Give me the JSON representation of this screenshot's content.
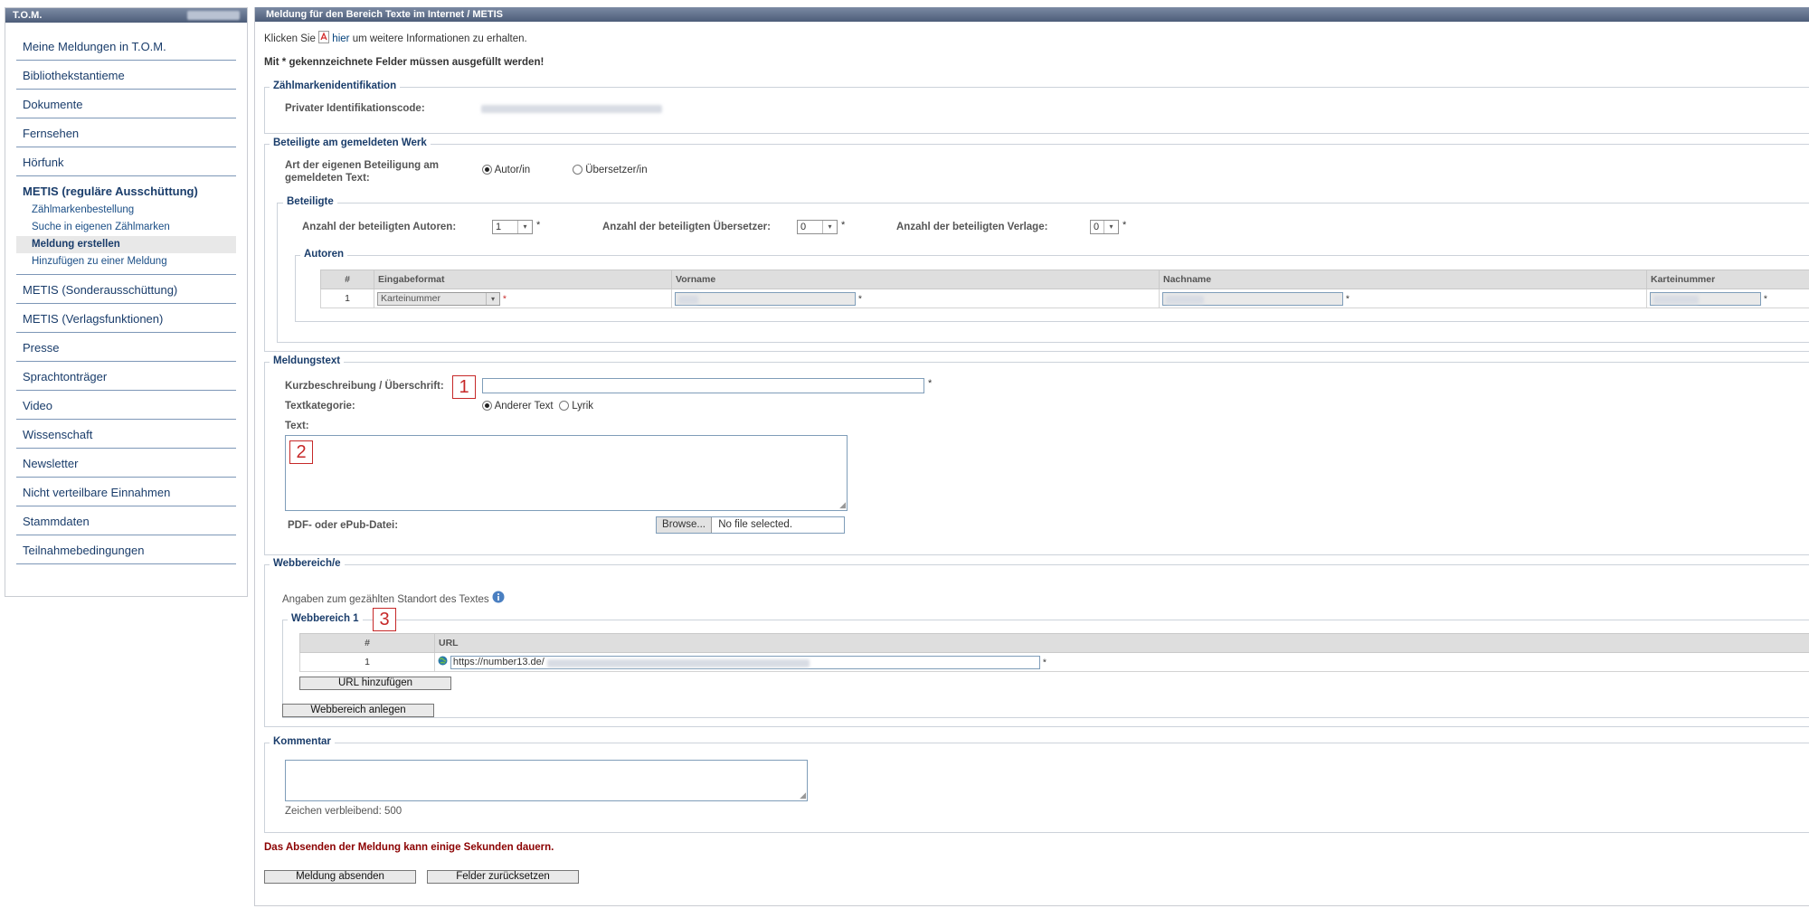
{
  "sidebar": {
    "title": "T.O.M.",
    "items": [
      {
        "label": "Meine Meldungen in T.O.M."
      },
      {
        "label": "Bibliothekstantieme"
      },
      {
        "label": "Dokumente"
      },
      {
        "label": "Fernsehen"
      },
      {
        "label": "Hörfunk"
      },
      {
        "label": "METIS (reguläre Ausschüttung)"
      },
      {
        "label": "METIS (Sonderausschüttung)"
      },
      {
        "label": "METIS (Verlagsfunktionen)"
      },
      {
        "label": "Presse"
      },
      {
        "label": "Sprachtonträger"
      },
      {
        "label": "Video"
      },
      {
        "label": "Wissenschaft"
      },
      {
        "label": "Newsletter"
      },
      {
        "label": "Nicht verteilbare Einnahmen"
      },
      {
        "label": "Stammdaten"
      },
      {
        "label": "Teilnahmebedingungen"
      }
    ],
    "subitems": [
      {
        "label": "Zählmarkenbestellung"
      },
      {
        "label": "Suche in eigenen Zählmarken"
      },
      {
        "label": "Meldung erstellen"
      },
      {
        "label": "Hinzufügen zu einer Meldung"
      }
    ]
  },
  "main": {
    "title": "Meldung für den Bereich Texte im Internet / METIS",
    "info_prefix": "Klicken Sie",
    "info_link": "hier",
    "info_suffix": "um weitere Informationen zu erhalten.",
    "required_note": "Mit * gekennzeichnete Felder müssen ausgefüllt werden!",
    "zaehlmarke": {
      "legend": "Zählmarkenidentifikation",
      "code_label": "Privater Identifikationscode:"
    },
    "beteiligte": {
      "legend": "Beteiligte am gemeldeten Werk",
      "art_label": "Art der eigenen Beteiligung am gemeldeten Text:",
      "opt_autor": "Autor/in",
      "opt_uebersetzer": "Übersetzer/in",
      "sub_legend": "Beteiligte",
      "autoren_label": "Anzahl der beteiligten Autoren:",
      "autoren_value": "1",
      "uebersetzer_label": "Anzahl der beteiligten Übersetzer:",
      "uebersetzer_value": "0",
      "verlage_label": "Anzahl der beteiligten Verlage:",
      "verlage_value": "0",
      "autoren_legend": "Autoren",
      "table_headers": [
        "#",
        "Eingabeformat",
        "Vorname",
        "Nachname",
        "Karteinummer"
      ],
      "row_num": "1",
      "row_format": "Karteinummer"
    },
    "meldungstext": {
      "legend": "Meldungstext",
      "kurz_label": "Kurzbeschreibung / Überschrift:",
      "kat_label": "Textkategorie:",
      "opt_anderer": "Anderer Text",
      "opt_lyrik": "Lyrik",
      "text_label": "Text:",
      "pdf_label": "PDF- oder ePub-Datei:",
      "browse": "Browse...",
      "no_file": "No file selected."
    },
    "webbereich": {
      "legend": "Webbereich/e",
      "hint": "Angaben zum gezählten Standort des Textes",
      "sub_legend": "Webbereich 1",
      "table_headers": [
        "#",
        "URL"
      ],
      "row_num": "1",
      "url_value": "https://number13.de/",
      "add_url": "URL hinzufügen",
      "add_webbereich": "Webbereich anlegen"
    },
    "kommentar": {
      "legend": "Kommentar",
      "remaining": "Zeichen verbleibend: 500"
    },
    "warning": "Das Absenden der Meldung kann einige Sekunden dauern.",
    "submit": "Meldung absenden",
    "reset": "Felder zurücksetzen"
  },
  "annotations": [
    "1",
    "2",
    "3"
  ],
  "required_mark": "*",
  "colors": {
    "header_bar": "#5a6a85",
    "link": "#1a3d6b",
    "warning": "#8b0000",
    "annotation": "#c62828"
  }
}
